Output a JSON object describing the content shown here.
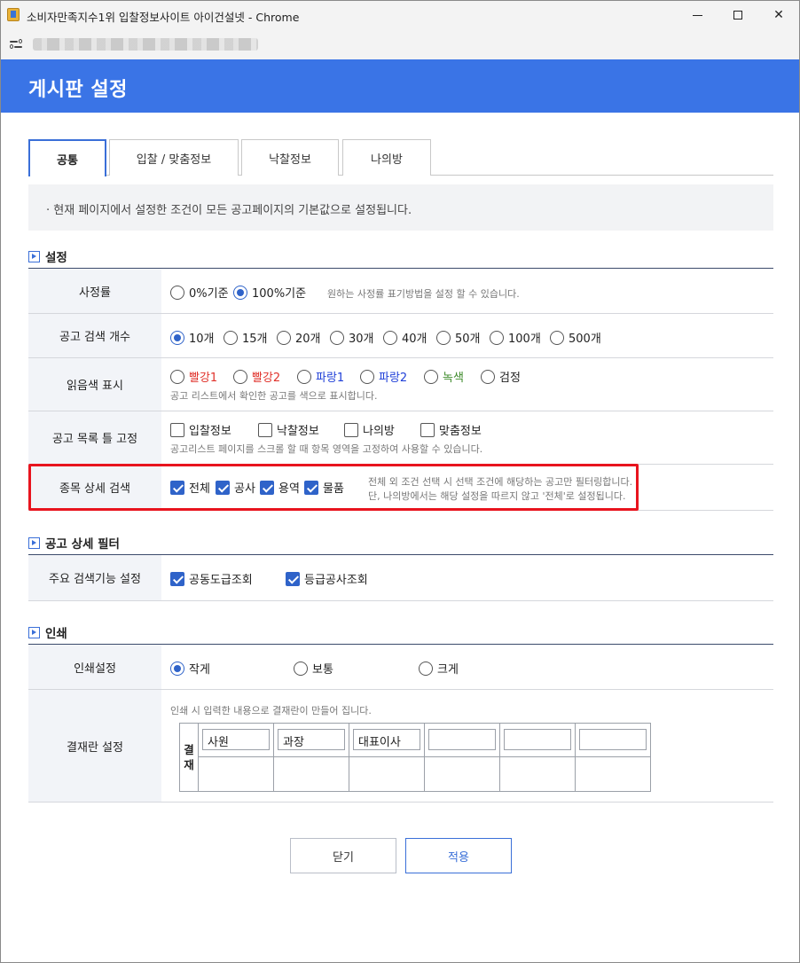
{
  "window": {
    "title": "소비자만족지수1위 입찰정보사이트 아이건설넷 - Chrome"
  },
  "header": {
    "title": "게시판 설정"
  },
  "tabs": [
    {
      "label": "공통",
      "active": true
    },
    {
      "label": "입찰 / 맞춤정보",
      "active": false
    },
    {
      "label": "낙찰정보",
      "active": false
    },
    {
      "label": "나의방",
      "active": false
    }
  ],
  "notice": "· 현재 페이지에서 설정한 조건이 모든 공고페이지의 기본값으로 설정됩니다.",
  "settings": {
    "title": "설정",
    "rate": {
      "label": "사정률",
      "options": [
        {
          "label": "0%기준",
          "checked": false
        },
        {
          "label": "100%기준",
          "checked": true
        }
      ],
      "hint": "원하는 사정률 표기방법을 설정 할 수 있습니다."
    },
    "count": {
      "label": "공고 검색 개수",
      "options": [
        {
          "label": "10개",
          "checked": true
        },
        {
          "label": "15개",
          "checked": false
        },
        {
          "label": "20개",
          "checked": false
        },
        {
          "label": "30개",
          "checked": false
        },
        {
          "label": "40개",
          "checked": false
        },
        {
          "label": "50개",
          "checked": false
        },
        {
          "label": "100개",
          "checked": false
        },
        {
          "label": "500개",
          "checked": false
        }
      ]
    },
    "read_color": {
      "label": "읽음색 표시",
      "options": [
        {
          "label": "빨강1",
          "color": "#e0322b",
          "checked": false
        },
        {
          "label": "빨강2",
          "color": "#e0322b",
          "checked": false
        },
        {
          "label": "파랑1",
          "color": "#2040d8",
          "checked": false
        },
        {
          "label": "파랑2",
          "color": "#2040d8",
          "checked": false
        },
        {
          "label": "녹색",
          "color": "#3d8a2a",
          "checked": false
        },
        {
          "label": "검정",
          "color": "#222222",
          "checked": false
        }
      ],
      "hint": "공고 리스트에서 확인한 공고를 색으로 표시합니다."
    },
    "fix": {
      "label": "공고 목록 틀 고정",
      "options": [
        {
          "label": "입찰정보",
          "checked": false
        },
        {
          "label": "낙찰정보",
          "checked": false
        },
        {
          "label": "나의방",
          "checked": false
        },
        {
          "label": "맞춤정보",
          "checked": false
        }
      ],
      "hint": "공고리스트 페이지를 스크롤 할 때 항목 영역을 고정하여 사용할 수 있습니다."
    },
    "category": {
      "label": "종목 상세 검색",
      "options": [
        {
          "label": "전체",
          "checked": true
        },
        {
          "label": "공사",
          "checked": true
        },
        {
          "label": "용역",
          "checked": true
        },
        {
          "label": "물품",
          "checked": true
        }
      ],
      "hint1": "전체 외 조건 선택 시 선택 조건에 해당하는 공고만 필터링합니다.",
      "hint2": "단, 나의방에서는 해당 설정을 따르지 않고 '전체'로 설정됩니다."
    }
  },
  "filter": {
    "title": "공고 상세 필터",
    "main": {
      "label": "주요 검색기능 설정",
      "options": [
        {
          "label": "공동도급조회",
          "checked": true
        },
        {
          "label": "등급공사조회",
          "checked": true
        }
      ]
    }
  },
  "print": {
    "title": "인쇄",
    "setting": {
      "label": "인쇄설정",
      "options": [
        {
          "label": "작게",
          "checked": true
        },
        {
          "label": "보통",
          "checked": false
        },
        {
          "label": "크게",
          "checked": false
        }
      ]
    },
    "approval": {
      "label": "결재란 설정",
      "hint": "인쇄 시 입력한 내용으로 결재란이 만들어 집니다.",
      "head_1": "결",
      "head_2": "재",
      "fields": [
        "사원",
        "과장",
        "대표이사",
        "",
        "",
        ""
      ]
    }
  },
  "buttons": {
    "close": "닫기",
    "apply": "적용"
  },
  "colors": {
    "brand": "#3a74e6",
    "accent": "#2f63c9",
    "highlight": "#e8141e"
  }
}
